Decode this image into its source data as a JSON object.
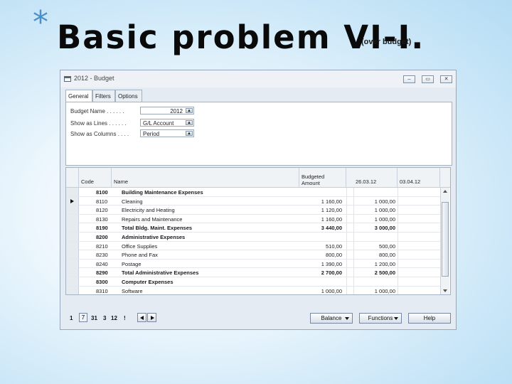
{
  "slide": {
    "bullet": "*",
    "title": "Basic problem VI-I.",
    "subtitle": "(over budget)"
  },
  "window": {
    "title": "2012 - Budget",
    "buttons": [
      "minimize",
      "restore",
      "close"
    ]
  },
  "tabs": [
    "General",
    "Filters",
    "Options"
  ],
  "active_tab": "General",
  "general": {
    "fields": [
      {
        "label": "Budget Name . . . . . .",
        "value": "2012"
      },
      {
        "label": "Show as Lines . . . . . .",
        "value": "G/L Account"
      },
      {
        "label": "Show as Columns . . . .",
        "value": "Period"
      }
    ]
  },
  "grid": {
    "columns": [
      "Code",
      "Name",
      "Budgeted Amount",
      "26.03.12",
      "03.04.12"
    ],
    "rows": [
      {
        "code": "8100",
        "name": "Building Maintenance Expenses",
        "amount": "",
        "p1": "",
        "total": true,
        "selected": false
      },
      {
        "code": "8110",
        "name": "Cleaning",
        "amount": "1 160,00",
        "p1": "1 000,00",
        "total": false,
        "selected": true
      },
      {
        "code": "8120",
        "name": "Electricity and Heating",
        "amount": "1 120,00",
        "p1": "1 000,00",
        "total": false,
        "selected": false
      },
      {
        "code": "8130",
        "name": "Repairs and Maintenance",
        "amount": "1 160,00",
        "p1": "1 000,00",
        "total": false,
        "selected": false
      },
      {
        "code": "8190",
        "name": "Total Bldg. Maint. Expenses",
        "amount": "3 440,00",
        "p1": "3 000,00",
        "total": true,
        "selected": false
      },
      {
        "code": "8200",
        "name": "Administrative Expenses",
        "amount": "",
        "p1": "",
        "total": true,
        "selected": false
      },
      {
        "code": "8210",
        "name": "Office Supplies",
        "amount": "510,00",
        "p1": "500,00",
        "total": false,
        "selected": false
      },
      {
        "code": "8230",
        "name": "Phone and Fax",
        "amount": "800,00",
        "p1": "800,00",
        "total": false,
        "selected": false
      },
      {
        "code": "8240",
        "name": "Postage",
        "amount": "1 390,00",
        "p1": "1 200,00",
        "total": false,
        "selected": false
      },
      {
        "code": "8290",
        "name": "Total Administrative Expenses",
        "amount": "2 700,00",
        "p1": "2 500,00",
        "total": true,
        "selected": false
      },
      {
        "code": "8300",
        "name": "Computer Expenses",
        "amount": "",
        "p1": "",
        "total": true,
        "selected": false
      },
      {
        "code": "8310",
        "name": "Software",
        "amount": "1 000,00",
        "p1": "1 000,00",
        "total": false,
        "selected": false
      }
    ]
  },
  "footer": {
    "period_buttons": [
      "1",
      "7",
      "31",
      "3",
      "12",
      "!"
    ],
    "actions": [
      "Balance",
      "Functions",
      "Help"
    ]
  }
}
